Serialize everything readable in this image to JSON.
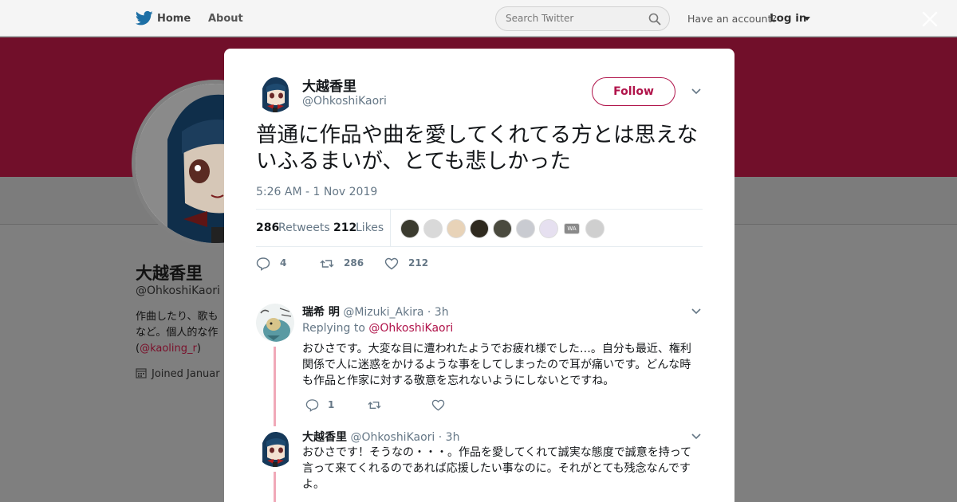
{
  "topbar": {
    "home_label": "Home",
    "about_label": "About",
    "search_placeholder": "Search Twitter",
    "have_account": "Have an account?",
    "login_label": "Log in"
  },
  "profile": {
    "name": "大越香里",
    "handle": "@OhkoshiKaori",
    "bio_line1": "作曲したり、歌も",
    "bio_line2": "など。個人的な作",
    "bio_link": "@kaoling_r",
    "joined": "Joined Januar"
  },
  "tweet": {
    "author_name": "大越香里",
    "author_handle": "@OhkoshiKaori",
    "follow_label": "Follow",
    "text": "普通に作品や曲を愛してくれてる方とは思えないふるまいが、とても悲しかった",
    "timestamp": "5:26 AM - 1 Nov 2019",
    "retweets_count": "286",
    "retweets_label": "Retweets",
    "likes_count": "212",
    "likes_label": "Likes",
    "likers": [
      "liker-1",
      "liker-2",
      "liker-3",
      "liker-4",
      "liker-5",
      "liker-6",
      "liker-7",
      "liker-8",
      "liker-9"
    ],
    "likers_colors": [
      "#3b3b2f",
      "#d9d9d9",
      "#e8d3b8",
      "#2f2a1f",
      "#4a4a3e",
      "#c9cbd1",
      "#e6e0f0",
      "#8a8a8a",
      "#cfcfcf"
    ],
    "liker_text": "WA",
    "actions": {
      "reply_count": "4",
      "retweet_count": "286",
      "like_count": "212"
    }
  },
  "replies": [
    {
      "name": "瑞希 明",
      "handle": "@Mizuki_Akira",
      "time": "· 3h",
      "replying_prefix": "Replying to",
      "replying_to": "@OhkoshiKaori",
      "text": "おひさです。大変な目に遭われたようでお疲れ様でした…。自分も最近、権利関係で人に迷惑をかけるような事をしてしまったので耳が痛いです。どんな時も作品と作家に対する敬意を忘れないようにしないとですね。",
      "reply_count": "1"
    },
    {
      "name": "大越香里",
      "handle": "@OhkoshiKaori",
      "time": "· 3h",
      "text": "おひさです！そうなの・・・。作品を愛してくれて誠実な態度で誠意を持って言って来てくれるのであれば応援したい事なのに。それがとても残念なんですよ。"
    }
  ],
  "colors": {
    "accent": "#b0134a",
    "banner": "#710f2a",
    "muted": "#657786"
  }
}
